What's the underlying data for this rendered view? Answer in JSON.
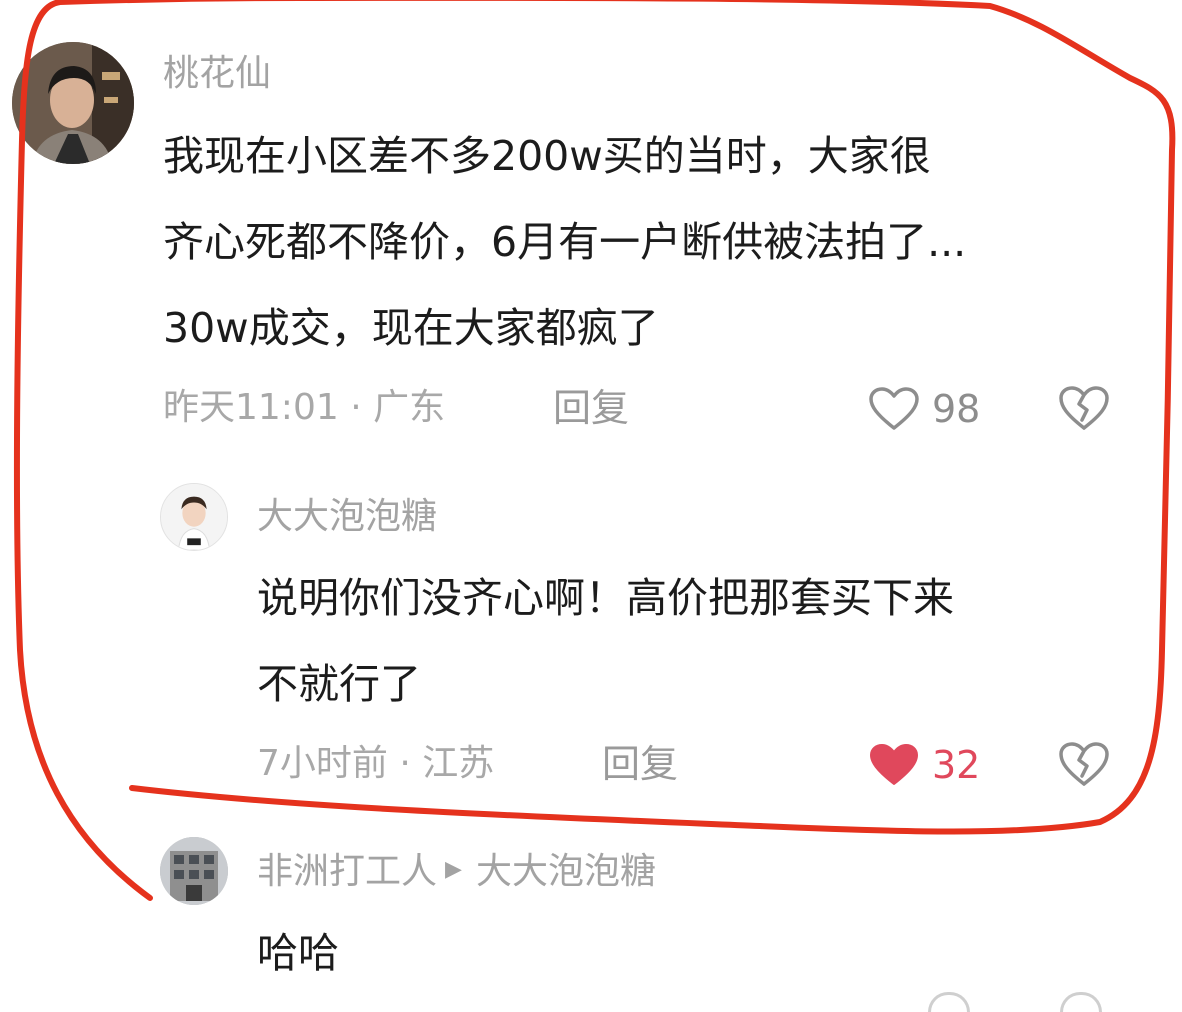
{
  "comments": [
    {
      "username": "桃花仙",
      "text_lines": [
        "我现在小区差不多200w买的当时，大家很",
        "齐心死都不降价，6月有一户断供被法拍了...",
        "30w成交，现在大家都疯了"
      ],
      "time": "昨天11:01",
      "location": "广东",
      "meta_sep": " · ",
      "reply_label": "回复",
      "likes": "98",
      "liked": false
    },
    {
      "username": "大大泡泡糖",
      "text_lines": [
        "说明你们没齐心啊！高价把那套买下来",
        "不就行了"
      ],
      "time": "7小时前",
      "location": "江苏",
      "meta_sep": " · ",
      "reply_label": "回复",
      "likes": "32",
      "liked": true
    },
    {
      "username": "非洲打工人",
      "reply_to": "大大泡泡糖",
      "text_lines": [
        "哈哈"
      ]
    }
  ],
  "icons": {
    "like": "heart-outline-icon",
    "liked": "heart-filled-icon",
    "dislike": "broken-heart-icon",
    "reply_to": "triangle-right-icon"
  },
  "colors": {
    "username": "#a3a3a3",
    "text": "#1c1c1c",
    "meta": "#a8a8a8",
    "liked": "#e0485c",
    "annotation": "#e5321d"
  }
}
